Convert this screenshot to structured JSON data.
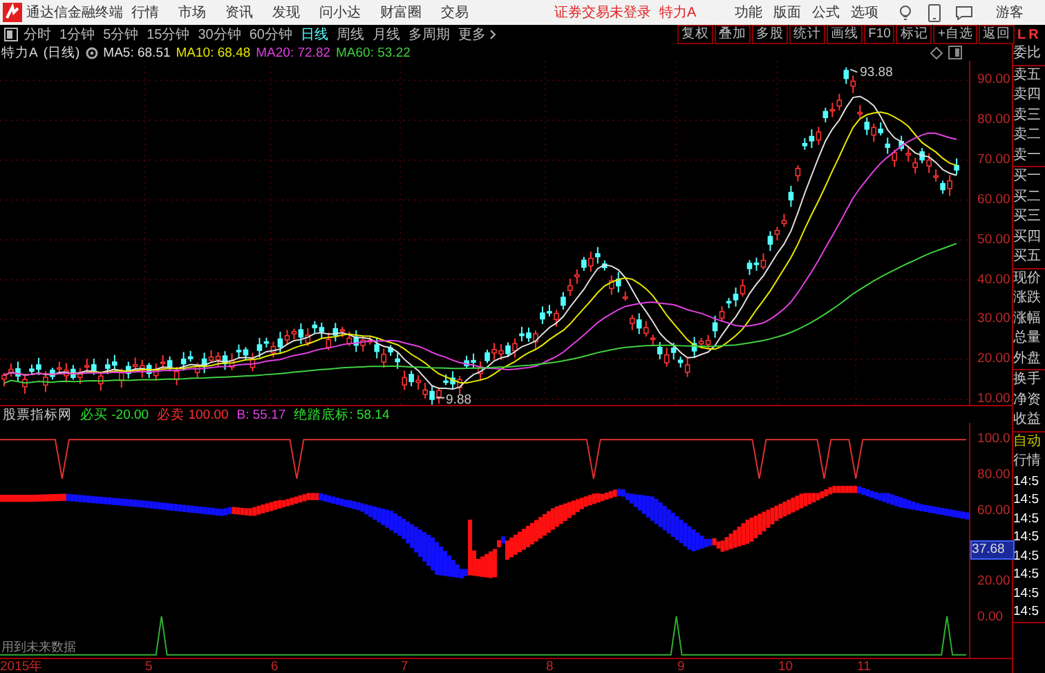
{
  "app": {
    "name": "通达信金融终端",
    "menus": [
      "行情",
      "市场",
      "资讯",
      "发现",
      "问小达",
      "财富圈",
      "交易"
    ],
    "login_status": "证券交易未登录",
    "stock": "特力A",
    "right_menus": [
      "功能",
      "版面",
      "公式",
      "选项"
    ],
    "user": "游客"
  },
  "periods": [
    {
      "label": "分时",
      "selected": false
    },
    {
      "label": "1分钟",
      "selected": false
    },
    {
      "label": "5分钟",
      "selected": false
    },
    {
      "label": "15分钟",
      "selected": false
    },
    {
      "label": "30分钟",
      "selected": false
    },
    {
      "label": "60分钟",
      "selected": false
    },
    {
      "label": "日线",
      "selected": true
    },
    {
      "label": "周线",
      "selected": false
    },
    {
      "label": "月线",
      "selected": false
    },
    {
      "label": "多周期",
      "selected": false
    },
    {
      "label": "更多",
      "selected": false
    }
  ],
  "tools": [
    "复权",
    "叠加",
    "多股",
    "统计",
    "画线",
    "F10",
    "标记",
    "+自选",
    "返回"
  ],
  "chart": {
    "title": "特力A",
    "period": "(日线)",
    "ma": [
      {
        "label": "MA5:",
        "value": "68.51",
        "color": "#e0e0e0"
      },
      {
        "label": "MA10:",
        "value": "68.48",
        "color": "#e8e800"
      },
      {
        "label": "MA20:",
        "value": "72.82",
        "color": "#e040e0"
      },
      {
        "label": "MA60:",
        "value": "53.22",
        "color": "#40d040"
      }
    ],
    "high_label": "93.88",
    "low_label": "9.88",
    "price_ticks": [
      "90.00",
      "80.00",
      "70.00",
      "60.00",
      "50.00",
      "40.00",
      "30.00",
      "20.00",
      "10.00"
    ]
  },
  "indicator": {
    "name": "股票指标网",
    "items": [
      {
        "label": "必买",
        "value": "-20.00",
        "color": "#30e030"
      },
      {
        "label": "必卖",
        "value": "100.00",
        "color": "#ff3030"
      },
      {
        "label": "B:",
        "value": "55.17",
        "color": "#e040e0"
      },
      {
        "label": "绝踏底标:",
        "value": "58.14",
        "color": "#30e030"
      }
    ],
    "ticks": [
      "100.0",
      "80.00",
      "60.00",
      "20.00",
      "0.00"
    ],
    "current": "37.68",
    "note": "用到未来数据"
  },
  "dates": [
    "2015年",
    "5",
    "6",
    "7",
    "8",
    "9",
    "10",
    "11"
  ],
  "quote_panel": {
    "header": [
      "L",
      "R"
    ],
    "groups": [
      [
        "委比"
      ],
      [
        "卖五",
        "卖四",
        "卖三",
        "卖二",
        "卖一"
      ],
      [
        "买一",
        "买二",
        "买三",
        "买四",
        "买五"
      ],
      [
        "现价",
        "涨跌",
        "涨幅",
        "总量",
        "外盘"
      ],
      [
        "换手",
        "净资",
        "收益"
      ]
    ],
    "mode": "自动",
    "section": "行情",
    "times": [
      "14:5",
      "14:5",
      "14:5",
      "14:5",
      "14:5",
      "14:5",
      "14:5",
      "14:5"
    ]
  }
}
